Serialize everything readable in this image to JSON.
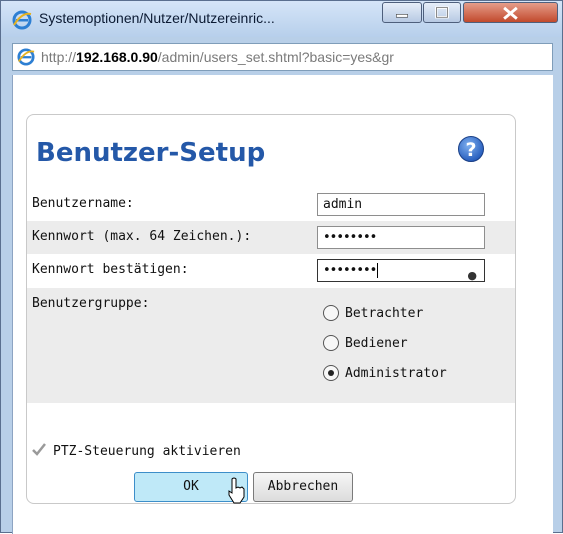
{
  "window": {
    "title": "Systemoptionen/Nutzer/Nutzereinric...",
    "address_prefix": "http://",
    "address_host": "192.168.0.90",
    "address_path": "/admin/users_set.shtml?basic=yes&gr"
  },
  "form": {
    "heading": "Benutzer-Setup",
    "username_label": "Benutzername:",
    "username_value": "admin",
    "password_label": "Kennwort (max. 64 Zeichen.):",
    "password_value": "••••••••",
    "confirm_label": "Kennwort bestätigen:",
    "confirm_value": "••••••••",
    "group_label": "Benutzergruppe:",
    "groups": [
      {
        "label": "Betrachter",
        "selected": false
      },
      {
        "label": "Bediener",
        "selected": false
      },
      {
        "label": "Administrator",
        "selected": true
      }
    ],
    "ptz_label": "PTZ-Steuerung aktivieren",
    "ptz_checked": true,
    "ok_label": "OK",
    "cancel_label": "Abbrechen"
  },
  "colors": {
    "heading": "#2458a8",
    "ok_button": "#bfe9f8",
    "close_button": "#c24a2d"
  },
  "icons": [
    "ie-icon",
    "minimize-icon",
    "maximize-icon",
    "close-icon",
    "help-icon",
    "checkmark-icon",
    "cursor-icon"
  ]
}
